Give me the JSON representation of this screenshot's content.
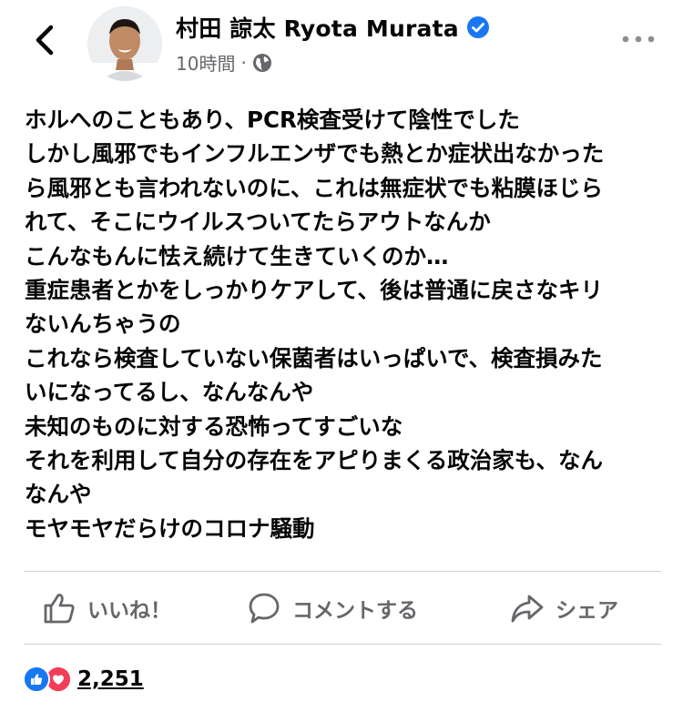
{
  "post": {
    "author": "村田 諒太 Ryota Murata",
    "time": "10時間",
    "separator": "·",
    "body_lines": [
      "ホルへのこともあり、PCR検査受けて陰性でした",
      "しかし風邪でもインフルエンザでも熱とか症状出なかった",
      "ら風邪とも言われないのに、これは無症状でも粘膜ほじら",
      "れて、そこにウイルスついてたらアウトなんか",
      "こんなもんに怯え続けて生きていくのか…",
      "重症患者とかをしっかりケアして、後は普通に戻さなキリ",
      "ないんちゃうの",
      "これなら検査していない保菌者はいっぱいで、検査損みた",
      "いになってるし、なんなんや",
      "未知のものに対する恐怖ってすごいな",
      "それを利用して自分の存在をアピりまくる政治家も、なん",
      "なんや",
      "モヤモヤだらけのコロナ騒動"
    ]
  },
  "actions": {
    "like": "いいね！",
    "comment": "コメントする",
    "share": "シェア"
  },
  "reactions": {
    "count": "2,251"
  },
  "colors": {
    "brand_blue": "#1877f2",
    "love_red": "#f33e58",
    "secondary_text": "#65676b"
  },
  "icons": [
    "back-arrow-icon",
    "verified-badge-icon",
    "globe-icon",
    "more-options-icon",
    "like-thumb-icon",
    "comment-bubble-icon",
    "share-arrow-icon",
    "like-reaction-icon",
    "love-reaction-icon"
  ]
}
